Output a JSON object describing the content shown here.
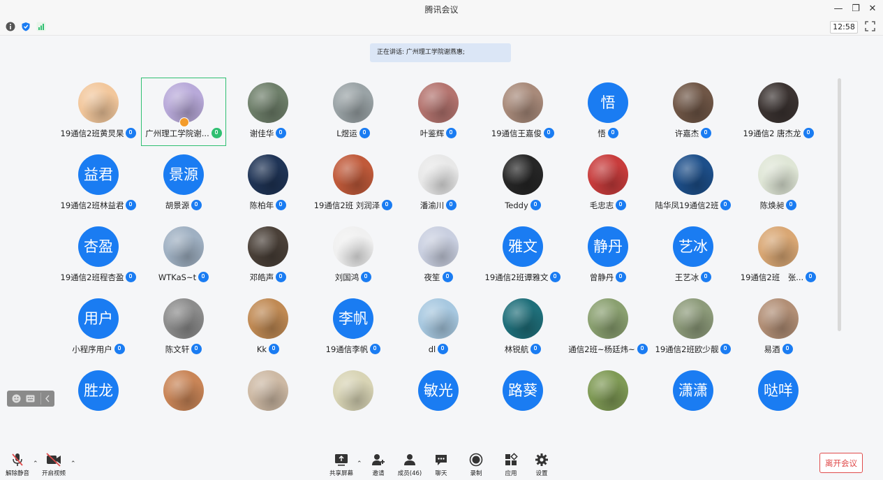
{
  "window": {
    "title": "腾讯会议"
  },
  "status": {
    "time": "12:58"
  },
  "speaking_banner": "正在讲话: 广州理工学院谢燕惠;",
  "participants": [
    {
      "name": "19通信2班黄炅杲",
      "avatar": "hamster-photo",
      "color": "#f2c79c"
    },
    {
      "name": "广州理工学院谢...",
      "avatar": "sky-photo",
      "color": "#b8a9d9",
      "speaking": true
    },
    {
      "name": "谢佳华",
      "avatar": "person-photo",
      "color": "#6e7f6a"
    },
    {
      "name": "L煜运",
      "avatar": "rabbit-photo",
      "color": "#9aa3a6"
    },
    {
      "name": "叶鉴辉",
      "avatar": "girl-photo",
      "color": "#b4746f"
    },
    {
      "name": "19通信王嘉俊",
      "avatar": "man-photo",
      "color": "#a88a7a"
    },
    {
      "name": "悟",
      "avatar_text": "悟"
    },
    {
      "name": "许嘉杰",
      "avatar": "room-photo",
      "color": "#6f5646"
    },
    {
      "name": "19通信2 唐杰龙",
      "avatar": "man-photo",
      "color": "#3b3331"
    },
    {
      "name": "19通信2班林益君",
      "avatar_text": "益君"
    },
    {
      "name": "胡景源",
      "avatar_text": "景源"
    },
    {
      "name": "陈柏年",
      "avatar": "night-photo",
      "color": "#1f3456"
    },
    {
      "name": "19通信2班 刘润泽",
      "avatar": "anime-photo",
      "color": "#c05a3a"
    },
    {
      "name": "潘渝川",
      "avatar": "cartoon-photo",
      "color": "#e8e8e8"
    },
    {
      "name": "Teddy",
      "avatar": "dark-photo",
      "color": "#262626"
    },
    {
      "name": "毛忠志",
      "avatar": "flag-photo",
      "color": "#c83c3c"
    },
    {
      "name": "陆华凤19通信2班",
      "avatar": "tech-photo",
      "color": "#1d4f8a"
    },
    {
      "name": "陈焕昶",
      "avatar": "meme-photo",
      "color": "#dfe6d6"
    },
    {
      "name": "19通信2班程杏盈",
      "avatar_text": "杏盈"
    },
    {
      "name": "WTKaS~t",
      "avatar": "dog-photo",
      "color": "#9fb0c2"
    },
    {
      "name": "邓皓声",
      "avatar": "man-photo",
      "color": "#4a4038"
    },
    {
      "name": "刘国鸿",
      "avatar": "duck-photo",
      "color": "#f0f0f0"
    },
    {
      "name": "夜笙",
      "avatar": "anime-photo",
      "color": "#c9cfe0"
    },
    {
      "name": "19通信2班谭雅文",
      "avatar_text": "雅文"
    },
    {
      "name": "曾静丹",
      "avatar_text": "静丹"
    },
    {
      "name": "王艺冰",
      "avatar_text": "艺冰"
    },
    {
      "name": "19通信2班　张...",
      "avatar": "cat-photo",
      "color": "#d9a774"
    },
    {
      "name": "小程序用户",
      "avatar_text": "用户"
    },
    {
      "name": "陈文轩",
      "avatar": "sketch-photo",
      "color": "#8c8c8c"
    },
    {
      "name": "Kk",
      "avatar": "shiba-photo",
      "color": "#c08a54"
    },
    {
      "name": "19通信李帆",
      "avatar_text": "李帆"
    },
    {
      "name": "dl",
      "avatar": "cartoon-photo",
      "color": "#a7c8e0"
    },
    {
      "name": "林锐航",
      "avatar": "man-photo",
      "color": "#1f6f7a"
    },
    {
      "name": "通信2班~杨廷炜~",
      "avatar": "couple-photo",
      "color": "#8aa070"
    },
    {
      "name": "19通信2班欧少靓",
      "avatar": "panda-photo",
      "color": "#8d9b7a"
    },
    {
      "name": "易酒",
      "avatar": "dog-photo",
      "color": "#b28f76"
    },
    {
      "avatar_text": "胜龙"
    },
    {
      "avatar": "cartoon-photo",
      "color": "#c98557"
    },
    {
      "avatar": "shiba-photo",
      "color": "#cdb9a4"
    },
    {
      "avatar": "sketch-photo",
      "color": "#d8d4b5"
    },
    {
      "avatar_text": "敏光"
    },
    {
      "avatar_text": "路葵"
    },
    {
      "avatar": "sheep-photo",
      "color": "#7f9a55"
    },
    {
      "avatar_text": "潇潇"
    },
    {
      "avatar_text": "哒咩"
    }
  ],
  "toolbar": {
    "unmute": "解除静音",
    "video": "开启视频",
    "share": "共享屏幕",
    "invite": "邀请",
    "members": "成员(46)",
    "chat": "聊天",
    "record": "录制",
    "apps": "应用",
    "settings": "设置",
    "leave": "离开会议"
  },
  "colors": {
    "accent": "#1a7cf2",
    "speaking_border": "#2fbf71",
    "leave": "#e04b4b"
  }
}
